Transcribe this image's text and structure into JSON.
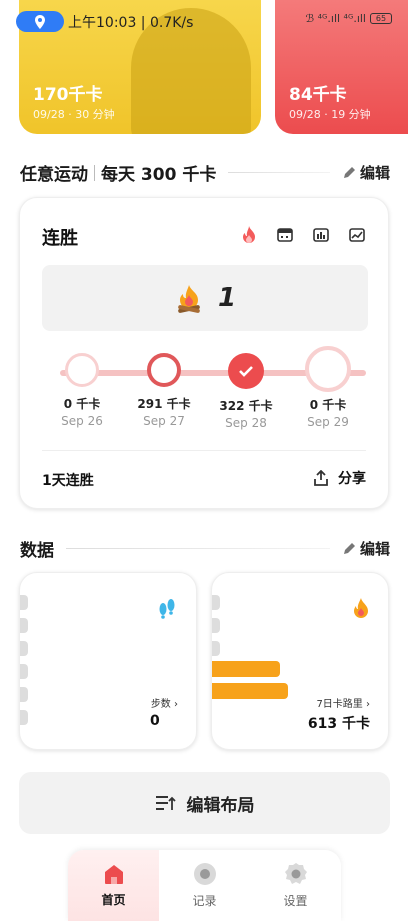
{
  "status_bar": {
    "time_speed": "上午10:03 | 0.7K/s",
    "network": "ℬ ⁴ᴳ.ıll ⁴ᴳ.ıll",
    "battery": "65"
  },
  "top_cards": [
    {
      "kcal": "170千卡",
      "sub": "09/28 · 30 分钟"
    },
    {
      "kcal": "84千卡",
      "sub": "09/28 · 19 分钟"
    }
  ],
  "sport_section": {
    "title": "任意运动",
    "goal": "每天 300 千卡",
    "edit_label": "编辑"
  },
  "streak": {
    "title": "连胜",
    "count": "1",
    "days": [
      {
        "value": "0 千卡",
        "date": "Sep 26"
      },
      {
        "value": "291 千卡",
        "date": "Sep 27"
      },
      {
        "value": "322 千卡",
        "date": "Sep 28"
      },
      {
        "value": "0 千卡",
        "date": "Sep 29"
      }
    ],
    "footer": "1天连胜",
    "share_label": "分享"
  },
  "data_section": {
    "title": "数据",
    "edit_label": "编辑"
  },
  "data_cards": [
    {
      "label": "步数",
      "value": "0"
    },
    {
      "label": "7日卡路里",
      "value": "613 千卡"
    }
  ],
  "edit_layout_label": "编辑布局",
  "nav": {
    "home": "首页",
    "records": "记录",
    "settings": "设置"
  },
  "colors": {
    "accent_red": "#ec4c4e",
    "yellow": "#f0c42a",
    "orange": "#f7a21b",
    "blue_pill": "#2f7cf6"
  }
}
